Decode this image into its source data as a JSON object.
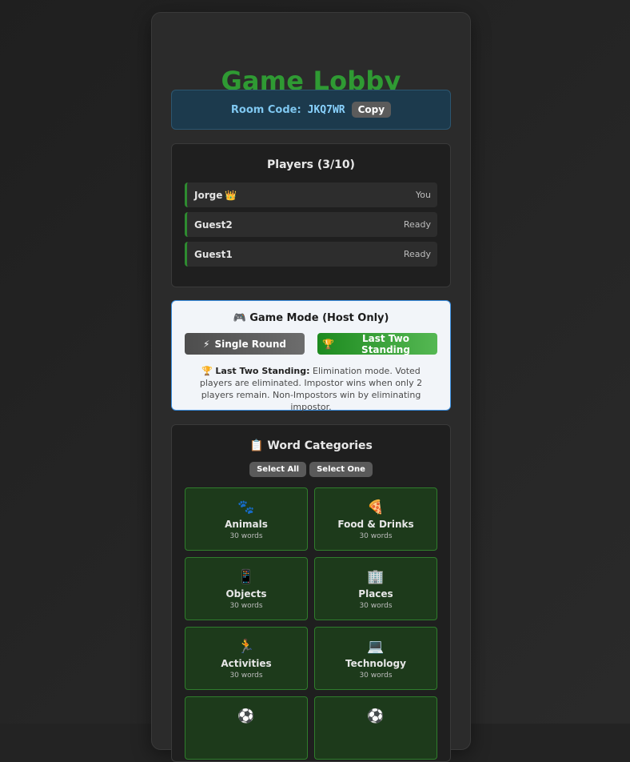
{
  "lobby": {
    "title": "Game Lobby",
    "room_label": "Room Code:",
    "room_code": "JKQ7WR",
    "copy_label": "Copy"
  },
  "players": {
    "title": "Players (3/10)",
    "list": [
      {
        "name": "Jorge",
        "icon": "crown-icon",
        "status": "You"
      },
      {
        "name": "Guest2",
        "status": "Ready"
      },
      {
        "name": "Guest1",
        "status": "Ready"
      }
    ]
  },
  "game_mode": {
    "icon": "🎮",
    "title": "Game Mode (Host Only)",
    "options": [
      {
        "icon": "⚡",
        "label": "Single Round",
        "selected": false
      },
      {
        "icon": "🏆",
        "label": "Last Two Standing",
        "selected": true
      }
    ],
    "desc_icon": "🏆",
    "desc_bold": "Last Two Standing:",
    "desc_text": "Elimination mode. Voted players are eliminated. Impostor wins when only 2 players remain. Non-Impostors win by eliminating impostor."
  },
  "categories": {
    "icon": "📋",
    "title": "Word Categories",
    "select_all": "Select All",
    "select_one": "Select One",
    "items": [
      {
        "icon": "🐾",
        "name": "Animals",
        "count": "30 words"
      },
      {
        "icon": "🍕",
        "name": "Food & Drinks",
        "count": "30 words"
      },
      {
        "icon": "📱",
        "name": "Objects",
        "count": "30 words"
      },
      {
        "icon": "🏢",
        "name": "Places",
        "count": "30 words"
      },
      {
        "icon": "🏃",
        "name": "Activities",
        "count": "30 words"
      },
      {
        "icon": "💻",
        "name": "Technology",
        "count": "30 words"
      },
      {
        "icon": "⚽",
        "name": "",
        "count": ""
      },
      {
        "icon": "⚽",
        "name": "",
        "count": ""
      }
    ]
  },
  "colors": {
    "accent_green": "#2f9a33",
    "room_blue": "#8ad3ff",
    "mode_border": "#3a8ee0"
  }
}
